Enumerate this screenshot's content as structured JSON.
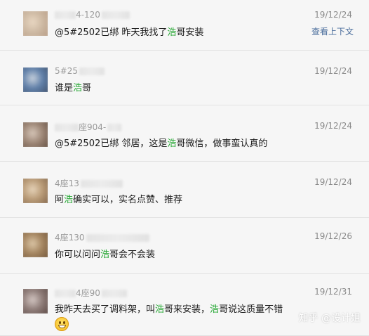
{
  "messages": [
    {
      "sender": "4-120",
      "date": "19/12/24",
      "body": [
        {
          "t": "@5#2502已绑 昨天我找了"
        },
        {
          "t": "浩",
          "hl": true
        },
        {
          "t": "哥安装"
        }
      ],
      "context_link": "查看上下文",
      "avatar_colors": [
        "#cdb9a3",
        "#e9d7c2",
        "#b59982"
      ]
    },
    {
      "sender": "5#25",
      "date": "19/12/24",
      "body": [
        {
          "t": "谁是"
        },
        {
          "t": "浩",
          "hl": true
        },
        {
          "t": "哥"
        }
      ],
      "avatar_colors": [
        "#5f7fa8",
        "#c7d0dc",
        "#3e4d66"
      ]
    },
    {
      "sender": "座904-",
      "date": "19/12/24",
      "body": [
        {
          "t": "@5#2502已绑 邻居，这是"
        },
        {
          "t": "浩",
          "hl": true
        },
        {
          "t": "哥微信，做事蛮认真的"
        }
      ],
      "avatar_colors": [
        "#9c8575",
        "#d6c6b8",
        "#5e4a3d"
      ]
    },
    {
      "sender": "4座13",
      "date": "19/12/24",
      "body": [
        {
          "t": "阿"
        },
        {
          "t": "浩",
          "hl": true
        },
        {
          "t": "确实可以，实名点赞、推荐"
        }
      ],
      "avatar_colors": [
        "#b89a76",
        "#e6d3b9",
        "#7d6148"
      ]
    },
    {
      "sender": "4座130",
      "date": "19/12/26",
      "body": [
        {
          "t": "你可以问问"
        },
        {
          "t": "浩",
          "hl": true
        },
        {
          "t": "哥会不会装"
        }
      ],
      "avatar_colors": [
        "#a3845f",
        "#dcc6a6",
        "#6d5238"
      ]
    },
    {
      "sender": "4座90",
      "date": "19/12/31",
      "body": [
        {
          "t": "我昨天去买了调料架，叫"
        },
        {
          "t": "浩",
          "hl": true
        },
        {
          "t": "哥来安装，"
        },
        {
          "t": "浩",
          "hl": true
        },
        {
          "t": "哥说这质量不错"
        }
      ],
      "emoji": "grinning-face",
      "avatar_colors": [
        "#8d7b77",
        "#d3c6c2",
        "#55433f"
      ]
    }
  ],
  "watermark": "知乎 @设计姐",
  "colors": {
    "highlight": "#26a834",
    "link": "#4a6d9c",
    "background": "#f6f6f6"
  }
}
